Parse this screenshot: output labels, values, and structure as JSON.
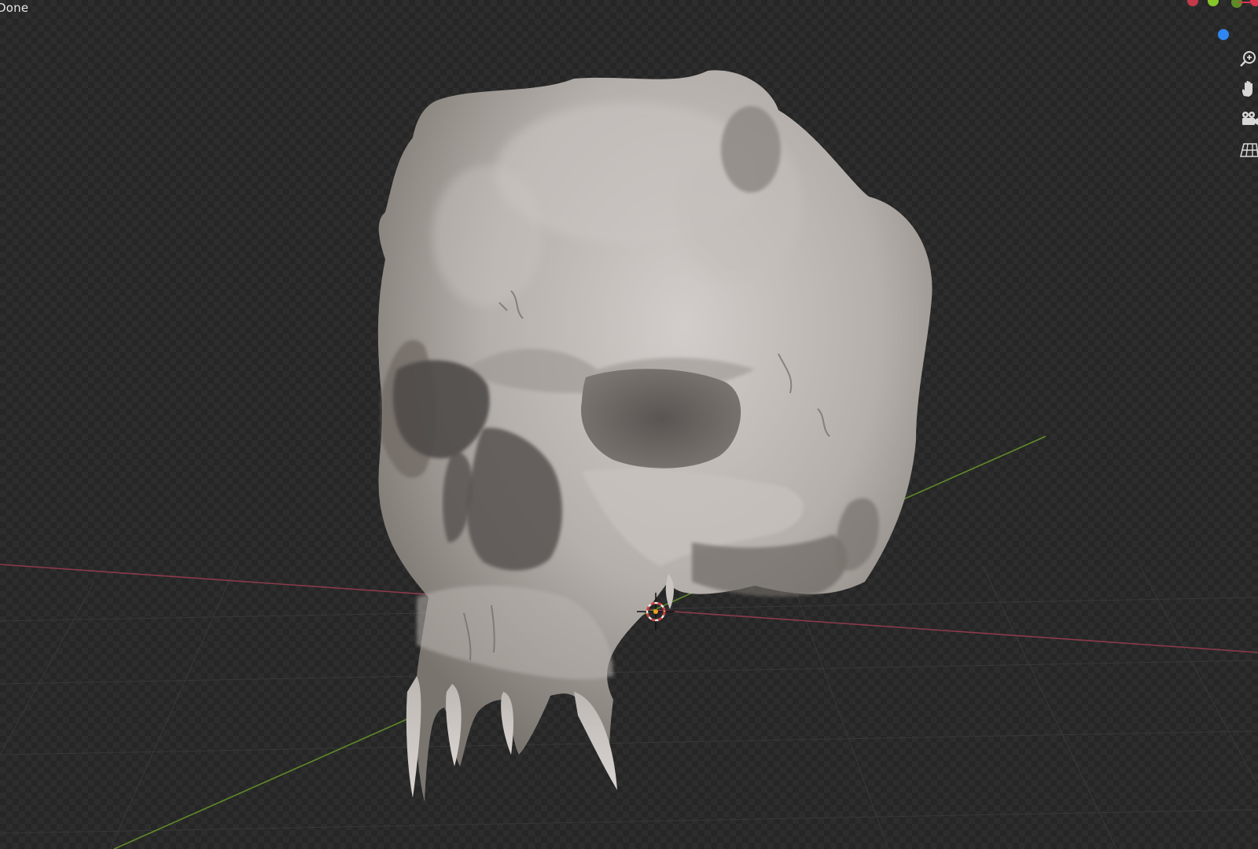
{
  "status": {
    "operation_text": "Done"
  },
  "navigation": {
    "gizmo": {
      "x_axis_color": "#d9384f",
      "y_axis_color": "#86c82a",
      "z_axis_color": "#2f86f0",
      "neg_color": "#c23a48"
    },
    "buttons": [
      {
        "name": "zoom-icon",
        "tooltip": ""
      },
      {
        "name": "pan-hand-icon",
        "tooltip": ""
      },
      {
        "name": "camera-icon",
        "tooltip": ""
      },
      {
        "name": "perspective-grid-icon",
        "tooltip": ""
      }
    ]
  },
  "scene": {
    "object": "skull-mesh",
    "x_axis_color": "#8a3a4a",
    "y_axis_color": "#5f8a28",
    "cursor": "3d-cursor"
  }
}
